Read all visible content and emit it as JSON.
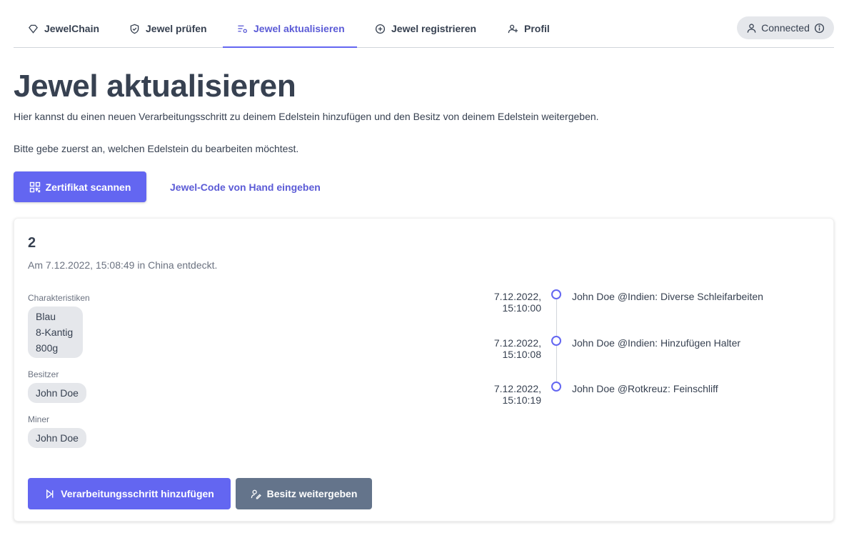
{
  "nav": {
    "tabs": [
      {
        "label": "JewelChain",
        "icon": "diamond-icon"
      },
      {
        "label": "Jewel prüfen",
        "icon": "shield-check-icon"
      },
      {
        "label": "Jewel aktualisieren",
        "icon": "list-edit-icon",
        "active": true
      },
      {
        "label": "Jewel registrieren",
        "icon": "plus-circle-icon"
      },
      {
        "label": "Profil",
        "icon": "user-plus-icon"
      }
    ],
    "status": {
      "label": "Connected",
      "icon": "info-icon",
      "user_icon": "user-icon"
    }
  },
  "page": {
    "title": "Jewel aktualisieren",
    "intro": "Hier kannst du einen neuen Verarbeitungsschritt zu deinem Edelstein hinzufügen und den Besitz von deinem Edelstein weitergeben.",
    "hint": "Bitte gebe zuerst an, welchen Edelstein du bearbeiten möchtest.",
    "scan_button": "Zertifikat scannen",
    "manual_link": "Jewel-Code von Hand eingeben"
  },
  "jewel": {
    "id": "2",
    "discovered": "Am 7.12.2022, 15:08:49 in China entdeckt.",
    "characteristics_label": "Charakteristiken",
    "characteristics": [
      "Blau",
      "8-Kantig",
      "800g"
    ],
    "owner_label": "Besitzer",
    "owner": "John Doe",
    "miner_label": "Miner",
    "miner": "John Doe",
    "history": [
      {
        "date": "7.12.2022, 15:10:00",
        "text": "John Doe @Indien: Diverse Schleifarbeiten"
      },
      {
        "date": "7.12.2022, 15:10:08",
        "text": "John Doe @Indien: Hinzufügen Halter"
      },
      {
        "date": "7.12.2022, 15:10:19",
        "text": "John Doe @Rotkreuz: Feinschliff"
      }
    ],
    "add_step_button": "Verarbeitungsschritt hinzufügen",
    "transfer_button": "Besitz weitergeben"
  },
  "colors": {
    "accent": "#6366f1",
    "secondary_button": "#64748b",
    "chip": "#e5e7eb"
  }
}
